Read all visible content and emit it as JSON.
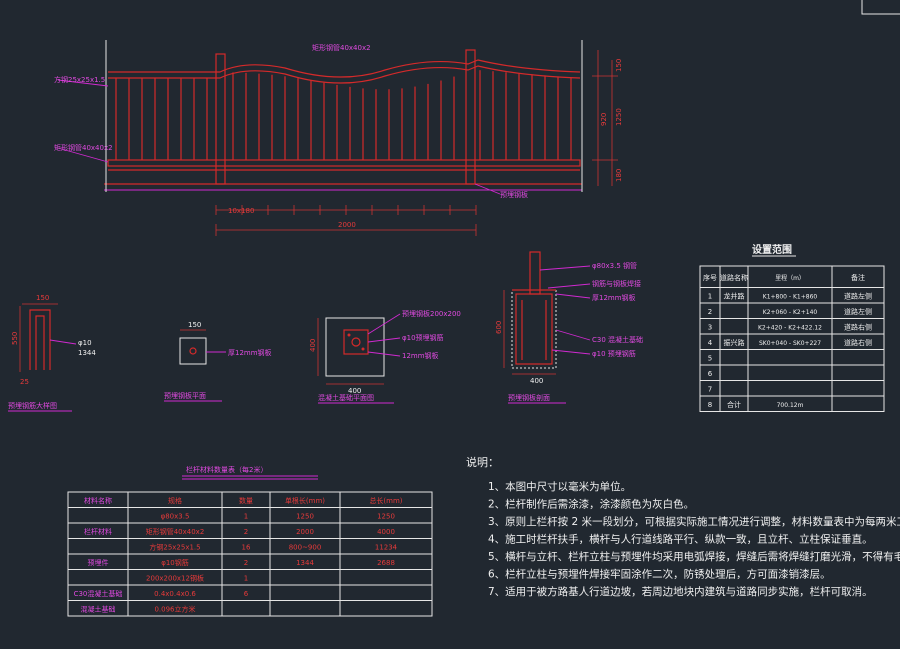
{
  "elevation": {
    "top_rail_label": "矩形钢管40x40x2",
    "baluster_label": "方钢25x25x1.5",
    "bottom_rail_label": "矩形钢管40x40x2",
    "right_tag": "预埋钢板",
    "right_dims": [
      "150",
      "920",
      "1250",
      "180"
    ],
    "spacing_text": "10x180",
    "total_width": "2000"
  },
  "details": {
    "embed_steel": {
      "title": "预埋钢筋大样图",
      "dims": [
        "150",
        "550",
        "25"
      ],
      "labels": [
        "φ10",
        "1344"
      ]
    },
    "embed_plate": {
      "title": "预埋钢板平面",
      "dims": [
        "150"
      ],
      "label": "厚12mm钢板"
    },
    "concrete_base": {
      "title": "混凝土基础平面图",
      "dims": [
        "400",
        "400"
      ],
      "labels": [
        "预埋钢板200x200",
        "φ10预埋钢筋",
        "12mm钢板"
      ]
    },
    "column_section": {
      "title": "预埋钢板剖面",
      "dims": [
        "600",
        "400"
      ],
      "labels": [
        "φ80x3.5 钢管",
        "钢筋与钢板焊接",
        "厚12mm钢板",
        "C30 混凝土基础",
        "φ10 预埋钢筋"
      ]
    }
  },
  "setup_table": {
    "title": "设置范围",
    "headers": [
      "序号",
      "道路名称",
      "里程（m）",
      "备注"
    ],
    "rows": [
      [
        "1",
        "龙井路",
        "K1+800 - K1+860",
        "道路左侧"
      ],
      [
        "2",
        "",
        "K2+060 - K2+140",
        "道路左侧"
      ],
      [
        "3",
        "",
        "K2+420 - K2+422.12",
        "道路右侧"
      ],
      [
        "4",
        "振兴路",
        "SK0+040 - SK0+227",
        "道路右侧"
      ],
      [
        "5",
        "",
        "",
        ""
      ],
      [
        "6",
        "",
        "",
        ""
      ],
      [
        "7",
        "",
        "",
        ""
      ],
      [
        "8",
        "合计",
        "700.12m",
        ""
      ]
    ]
  },
  "material_table": {
    "title": "栏杆材料数量表（每2米）",
    "headers": [
      "材料名称",
      "规格",
      "数量",
      "单根长(mm)",
      "总长(mm)"
    ],
    "rows": [
      [
        "",
        "φ80x3.5",
        "1",
        "1250",
        "1250"
      ],
      [
        "栏杆材料",
        "矩形钢管40x40x2",
        "2",
        "2000",
        "4000"
      ],
      [
        "",
        "方钢25x25x1.5",
        "16",
        "800~900",
        "11234"
      ],
      [
        "预埋件",
        "φ10钢筋",
        "2",
        "1344",
        "2688"
      ],
      [
        "",
        "200x200x12钢板",
        "1",
        "",
        ""
      ],
      [
        "C30混凝土基础",
        "0.4x0.4x0.6",
        "6",
        "",
        ""
      ],
      [
        "混凝土基础",
        "0.096立方米",
        "",
        "",
        ""
      ]
    ]
  },
  "notes": {
    "heading": "说明：",
    "items": [
      "1、本图中尺寸以毫米为单位。",
      "2、栏杆制作后需涂漆，涂漆颜色为灰白色。",
      "3、原则上栏杆按 2 米一段划分，可根据实际施工情况进行调整，材料数量表中为每两米工",
      "4、施工时栏杆扶手，横杆与人行道线路平行、纵款一致，且立杆、立柱保证垂直。",
      "5、横杆与立杆、栏杆立柱与预埋件均采用电弧焊接，焊缝后需将焊缝打磨光滑，不得有毛",
      "6、栏杆立柱与预埋件焊接牢固涂作二次，防锈处理后，方可面漆销漆层。",
      "7、适用于被方路基人行道边坡，若周边地块内建筑与道路同步实施，栏杆可取消。"
    ]
  }
}
